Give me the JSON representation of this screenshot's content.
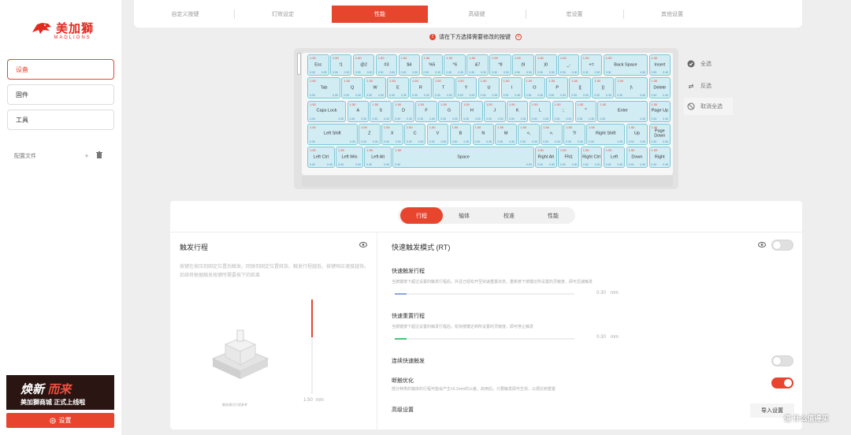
{
  "brand": {
    "name": "美加獅",
    "sub": "MADLIONS"
  },
  "sidebar": {
    "items": [
      {
        "label": "设备"
      },
      {
        "label": "固件"
      },
      {
        "label": "工具"
      }
    ],
    "config_label": "配置文件",
    "plus": "+"
  },
  "banner": {
    "line1a": "焕新",
    "line1b": "而来",
    "line2": "美加獅商城 正式上线啦"
  },
  "settings_button": "设置",
  "topnav": {
    "tabs": [
      "自定义按键",
      "灯效设定",
      "性能",
      "高级键",
      "宏设置",
      "其他设置"
    ]
  },
  "warning": "请在下方选择需要修改的按键",
  "keyboard": {
    "rows": [
      [
        {
          "l": "Esc"
        },
        {
          "l": "!1"
        },
        {
          "l": "@2"
        },
        {
          "l": "#3"
        },
        {
          "l": "$4"
        },
        {
          "l": "%5"
        },
        {
          "l": "^6"
        },
        {
          "l": "&7"
        },
        {
          "l": "*8"
        },
        {
          "l": "(9"
        },
        {
          "l": ")0"
        },
        {
          "l": "_-"
        },
        {
          "l": "+="
        },
        {
          "l": "Back Space"
        },
        {
          "l": "Insert"
        }
      ],
      [
        {
          "l": "Tab"
        },
        {
          "l": "Q"
        },
        {
          "l": "W"
        },
        {
          "l": "E"
        },
        {
          "l": "R"
        },
        {
          "l": "T"
        },
        {
          "l": "Y"
        },
        {
          "l": "U"
        },
        {
          "l": "I"
        },
        {
          "l": "O"
        },
        {
          "l": "P"
        },
        {
          "l": "{["
        },
        {
          "l": "}]"
        },
        {
          "l": "|\\"
        },
        {
          "l": "Delete"
        }
      ],
      [
        {
          "l": "Caps Lock"
        },
        {
          "l": "A"
        },
        {
          "l": "S"
        },
        {
          "l": "D"
        },
        {
          "l": "F"
        },
        {
          "l": "G"
        },
        {
          "l": "H"
        },
        {
          "l": "J"
        },
        {
          "l": "K"
        },
        {
          "l": "L"
        },
        {
          "l": ":;"
        },
        {
          "l": "\"'"
        },
        {
          "l": "Enter"
        },
        {
          "l": "Page Up"
        }
      ],
      [
        {
          "l": "Left Shift"
        },
        {
          "l": "Z"
        },
        {
          "l": "X"
        },
        {
          "l": "C"
        },
        {
          "l": "V"
        },
        {
          "l": "B"
        },
        {
          "l": "N"
        },
        {
          "l": "M"
        },
        {
          "l": "<,"
        },
        {
          "l": ">."
        },
        {
          "l": "?/"
        },
        {
          "l": "Right Shift"
        },
        {
          "l": "Up"
        },
        {
          "l": "Page Down"
        }
      ],
      [
        {
          "l": "Left Ctrl"
        },
        {
          "l": "Left Win"
        },
        {
          "l": "Left Alt"
        },
        {
          "l": "Space"
        },
        {
          "l": "Right Alt"
        },
        {
          "l": "FN1"
        },
        {
          "l": "Right Ctrl"
        },
        {
          "l": "Left"
        },
        {
          "l": "Down"
        },
        {
          "l": "Right"
        }
      ]
    ],
    "travel": "1.50",
    "press": "0.30",
    "release": "0.30"
  },
  "selection": {
    "all": "全选",
    "invert": "反选",
    "cancel": "取消全选"
  },
  "subtabs": [
    "行程",
    "轴体",
    "校准",
    "性能"
  ],
  "left_panel": {
    "title": "触发行程",
    "desc": "按键在按压到固定位置后触发。回弹到固定位置释放。触发行程越低，按键响应速度越快。后续将根据触发按键所需要按下的距离",
    "caption": "触发键位行程参考",
    "value": "1.50",
    "unit": "mm"
  },
  "right_panel": {
    "title": "快速触发模式 (RT)",
    "press": {
      "title": "快速触发行程",
      "desc": "当按键按下超过设置的触发行程后，并且已经松开至快速重置状态，重新按下按键达所设置的灵敏度，即可迅速触发",
      "value": "0.30",
      "unit": "mm"
    },
    "release": {
      "title": "快速重置行程",
      "desc": "当按键按下超过设置的触发行程后，松快按键达到所设置的灵敏度，即可停止触发",
      "value": "0.30",
      "unit": "mm"
    },
    "continuous": "连续快速触发",
    "debounce": {
      "title": "断触优化",
      "desc": "部分种类的轴体的行程可能会产生±0.2mm的公差，启用后，只要触发即可生效，以便达到重置"
    },
    "advanced": "高级设置",
    "import": "导入设置"
  },
  "watermark": "值 什么值得买",
  "colors": {
    "accent": "#e8452f",
    "key_fill": "#d2ecf4",
    "key_border": "#7dc7d7"
  }
}
